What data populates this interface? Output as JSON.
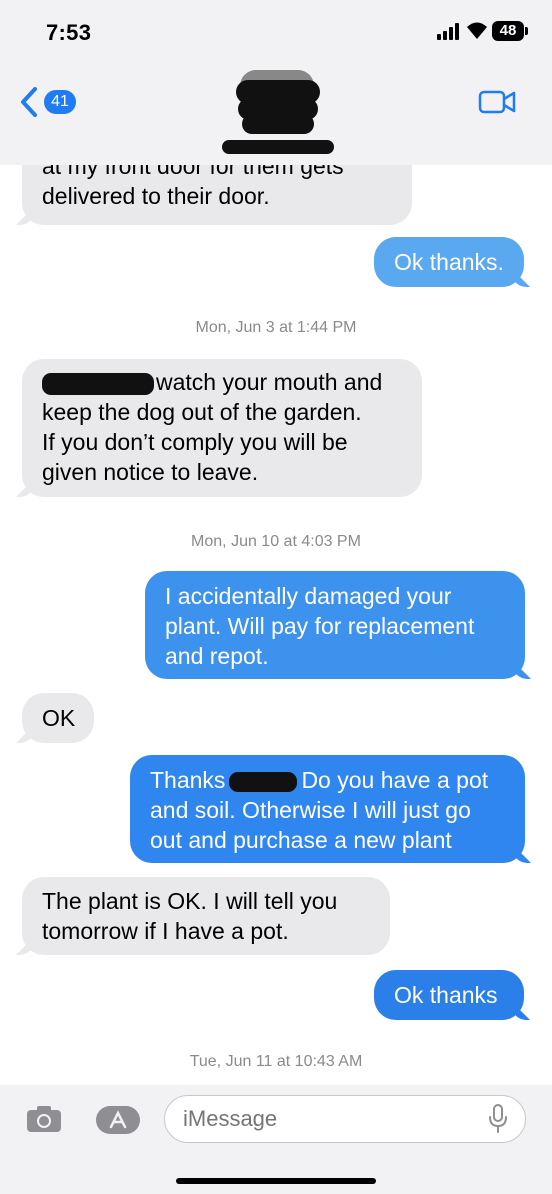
{
  "status": {
    "time": "7:53",
    "battery": "48"
  },
  "header": {
    "unread_count": "41"
  },
  "messages": [
    {
      "dir": "in",
      "lines": [
        "at my front door for them gets",
        "delivered to their door."
      ]
    },
    {
      "dir": "out",
      "lines": [
        "Ok thanks."
      ]
    },
    {
      "timestamp_day": "Mon, Jun 3",
      "timestamp_at": " at 1:44 PM"
    },
    {
      "dir": "in",
      "lines": [
        "watch your mouth and",
        "keep the dog out of the garden.",
        "If you don’t comply you will be",
        "given notice to leave."
      ]
    },
    {
      "timestamp_day": "Mon, Jun 10",
      "timestamp_at": " at 4:03 PM"
    },
    {
      "dir": "out",
      "lines": [
        "I accidentally damaged your",
        "plant. Will pay for replacement",
        "and repot."
      ]
    },
    {
      "dir": "in",
      "lines": [
        "OK"
      ]
    },
    {
      "dir": "out",
      "lines": [
        "Thanks",
        "Do you have a pot",
        "and soil. Otherwise I will just go",
        "out and purchase a new plant"
      ]
    },
    {
      "dir": "in",
      "lines": [
        "The plant is OK.  I will tell you",
        "tomorrow if I have a pot."
      ]
    },
    {
      "dir": "out",
      "lines": [
        "Ok thanks"
      ]
    },
    {
      "timestamp_day": "Tue, Jun 11",
      "timestamp_at": " at 10:43 AM"
    }
  ],
  "composer": {
    "placeholder": "iMessage"
  },
  "colors": {
    "incoming": "#e9e9eb",
    "outgoing_light": "#5aa8f0",
    "outgoing": "#2f86ee",
    "accent": "#1f7cf2"
  },
  "icons": [
    "back-chevron-icon",
    "video-call-icon",
    "camera-icon",
    "app-store-icon",
    "microphone-icon"
  ]
}
